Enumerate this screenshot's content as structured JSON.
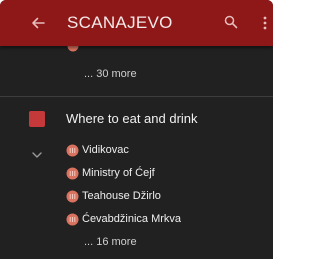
{
  "appbar": {
    "title": "SCANAJEVO",
    "back_icon": "arrow-left-icon",
    "search_icon": "search-icon",
    "more_icon": "more-vert-icon"
  },
  "previous_category": {
    "more_label": "... 30 more"
  },
  "category": {
    "title": "Where to eat and drink",
    "color": "#c6393a",
    "places": [
      {
        "name": "Vidikovac"
      },
      {
        "name": "Ministry of Ćejf"
      },
      {
        "name": "Teahouse Džirlo"
      },
      {
        "name": "Ćevabdžinica Mrkva"
      }
    ],
    "more_label": "... 16 more"
  },
  "colors": {
    "appbar": "#8e1717",
    "background": "#212121",
    "pin": "#d9735f"
  }
}
